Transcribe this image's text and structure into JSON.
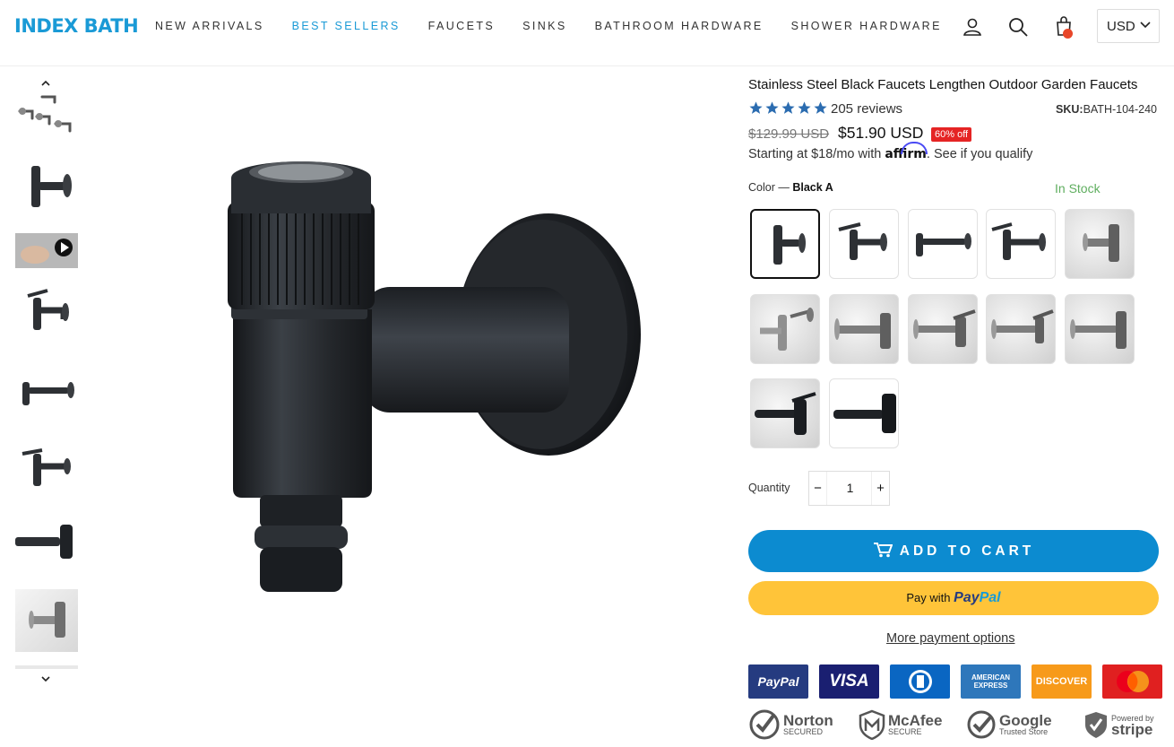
{
  "header": {
    "logo": "INDEX BATH",
    "nav": [
      "NEW ARRIVALS",
      "BEST SELLERS",
      "FAUCETS",
      "SINKS",
      "BATHROOM HARDWARE",
      "SHOWER HARDWARE"
    ],
    "active_nav": "BEST SELLERS",
    "currency": "USD",
    "accent_color": "#1a9ad6"
  },
  "product": {
    "title": "Stainless Steel Black Faucets Lengthen Outdoor Garden Faucets",
    "rating_stars": 5,
    "reviews": "205 reviews",
    "sku_label": "SKU:",
    "sku": "BATH-104-240",
    "old_price": "$129.99 USD",
    "price": "$51.90 USD",
    "discount": "60% off",
    "affirm_prefix": "Starting at $18/mo with",
    "affirm_brand": "affirm",
    "affirm_suffix": ". See if you qualify",
    "color_label": "Color —",
    "color_value": "Black A",
    "stock": "In Stock",
    "quantity_label": "Quantity",
    "quantity": "1",
    "add_to_cart": "ADD TO CART",
    "pay_with": "Pay with",
    "paypal_a": "Pay",
    "paypal_b": "Pal",
    "more_payment": "More payment options"
  },
  "payments": [
    "PayPal",
    "VISA",
    "Diners Club",
    "AMERICAN EXPRESS",
    "DISCOVER",
    "Mastercard"
  ],
  "trust_badges": [
    {
      "big": "Norton",
      "small": "SECURED"
    },
    {
      "big": "McAfee",
      "small": "SECURE"
    },
    {
      "big": "Google",
      "small": "Trusted Store"
    },
    {
      "big": "stripe",
      "small": "Powered by"
    }
  ]
}
